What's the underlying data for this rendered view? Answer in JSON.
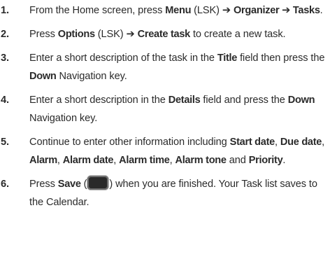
{
  "steps": [
    {
      "num": "1.",
      "parts": [
        {
          "t": "From the Home screen, press "
        },
        {
          "t": "Menu",
          "b": true
        },
        {
          "t": " (LSK) ➔ "
        },
        {
          "t": "Organizer ➔ Tasks",
          "b": true
        },
        {
          "t": "."
        }
      ]
    },
    {
      "num": "2.",
      "parts": [
        {
          "t": "Press "
        },
        {
          "t": "Options",
          "b": true
        },
        {
          "t": " (LSK) ➔ "
        },
        {
          "t": "Create task",
          "b": true
        },
        {
          "t": " to create a new task."
        }
      ]
    },
    {
      "num": "3.",
      "parts": [
        {
          "t": "Enter a short description of the task in the "
        },
        {
          "t": "Title",
          "b": true
        },
        {
          "t": " field then press the "
        },
        {
          "t": "Down",
          "b": true
        },
        {
          "t": " Navigation key."
        }
      ]
    },
    {
      "num": "4.",
      "parts": [
        {
          "t": "Enter a short description in the "
        },
        {
          "t": "Details",
          "b": true
        },
        {
          "t": " field and press the "
        },
        {
          "t": "Down",
          "b": true
        },
        {
          "t": " Navigation key."
        }
      ]
    },
    {
      "num": "5.",
      "parts": [
        {
          "t": "Continue to enter other information including "
        },
        {
          "t": "Start date",
          "b": true
        },
        {
          "t": ", "
        },
        {
          "t": "Due date",
          "b": true
        },
        {
          "t": ", "
        },
        {
          "t": "Alarm",
          "b": true
        },
        {
          "t": ", "
        },
        {
          "t": "Alarm date",
          "b": true
        },
        {
          "t": ", "
        },
        {
          "t": "Alarm time",
          "b": true
        },
        {
          "t": ", "
        },
        {
          "t": "Alarm tone",
          "b": true
        },
        {
          "t": " and "
        },
        {
          "t": "Priority",
          "b": true
        },
        {
          "t": "."
        }
      ]
    },
    {
      "num": "6.",
      "parts": [
        {
          "t": "Press "
        },
        {
          "t": "Save",
          "b": true
        },
        {
          "t": " ("
        },
        {
          "icon": "save-key-icon"
        },
        {
          "t": ") when you are finished. Your Task list saves to the Calendar."
        }
      ]
    }
  ]
}
